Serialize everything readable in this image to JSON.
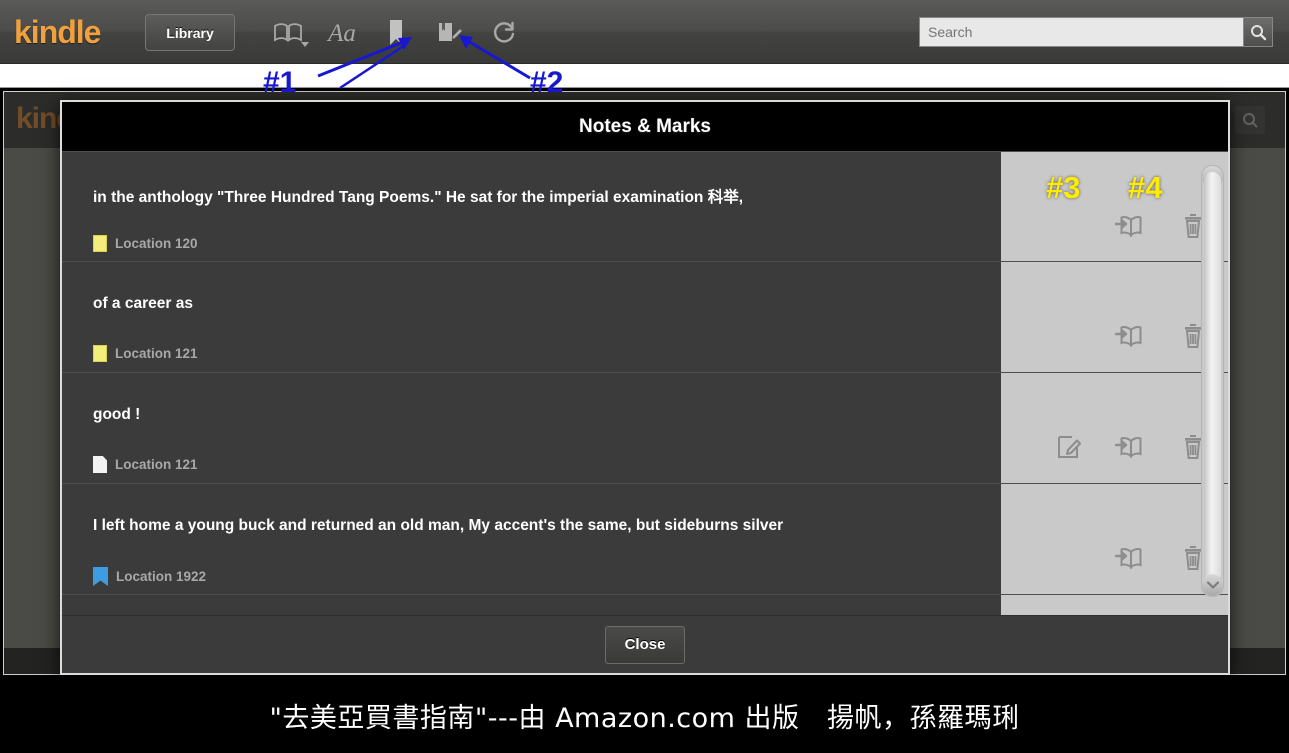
{
  "toolbar": {
    "logo": "kindle",
    "library_label": "Library",
    "icons": [
      {
        "name": "open-book-icon",
        "label": "Go to"
      },
      {
        "name": "font-size-icon",
        "label": "Aa"
      },
      {
        "name": "bookmark-icon",
        "label": "Bookmark"
      },
      {
        "name": "notes-marks-icon",
        "label": "Notes & Marks"
      },
      {
        "name": "sync-refresh-icon",
        "label": "Sync"
      }
    ]
  },
  "search": {
    "placeholder": "Search",
    "value": "",
    "button_icon": "search-icon"
  },
  "dialog": {
    "title": "Notes & Marks",
    "close_label": "Close",
    "rows": [
      {
        "text": "in the anthology \"Three Hundred Tang Poems.\" He sat for the imperial examination 科举,",
        "location": "Location 120",
        "marker": "highlight-yellow",
        "actions": [
          "goto-location-icon",
          "delete-icon"
        ]
      },
      {
        "text": "of a career as",
        "location": "Location 121",
        "marker": "highlight-yellow",
        "actions": [
          "goto-location-icon",
          "delete-icon"
        ]
      },
      {
        "text": "good !",
        "location": "Location 121",
        "marker": "note",
        "actions": [
          "edit-note-icon",
          "goto-location-icon",
          "delete-icon"
        ]
      },
      {
        "text": "I left home a young buck and returned an old man, My accent's the same, but sideburns silver",
        "location": "Location 1922",
        "marker": "bookmark",
        "actions": [
          "goto-location-icon",
          "delete-icon"
        ]
      }
    ],
    "scrollbar": {
      "up_icon": "chevron-up-icon",
      "down_icon": "chevron-down-icon"
    }
  },
  "annotations": [
    {
      "id": "a1",
      "label": "#1",
      "color": "#1718d0"
    },
    {
      "id": "a2",
      "label": "#2",
      "color": "#1718d0"
    },
    {
      "id": "a3",
      "label": "#3",
      "color": "#ffec00"
    },
    {
      "id": "a4",
      "label": "#4",
      "color": "#ffec00"
    }
  ],
  "caption": {
    "text": "\"去美亞買書指南\"---由 Amazon.com 出版　揚帆，孫羅瑪琍"
  },
  "background_window": {
    "logo": "kindle"
  }
}
